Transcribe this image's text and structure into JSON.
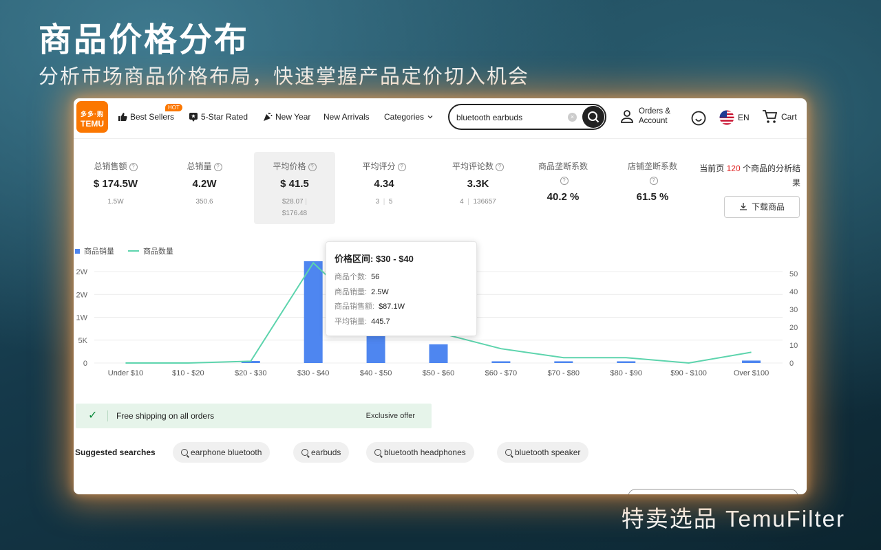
{
  "hero": {
    "title": "商品价格分布",
    "subtitle": "分析市场商品价格布局，快速掌握产品定价切入机会",
    "brand": "特卖选品 TemuFilter"
  },
  "nav": {
    "logo_line1": "多多·购",
    "logo_line2": "TEMU",
    "items": [
      "Best Sellers",
      "5-Star Rated",
      "New Year",
      "New Arrivals",
      "Categories"
    ],
    "hot_badge": "HOT",
    "search_value": "bluetooth earbuds",
    "orders_line1": "Orders &",
    "orders_line2": "Account",
    "lang": "EN",
    "cart": "Cart"
  },
  "stats": [
    {
      "label": "总销售额",
      "value": "$ 174.5W",
      "sub1": "1.5W",
      "sub2": ""
    },
    {
      "label": "总销量",
      "value": "4.2W",
      "sub1": "350.6",
      "sub2": ""
    },
    {
      "label": "平均价格",
      "value": "$ 41.5",
      "sub1": "$28.07",
      "sub2": "$176.48"
    },
    {
      "label": "平均评分",
      "value": "4.34",
      "sub1": "3",
      "sub2": "5"
    },
    {
      "label": "平均评论数",
      "value": "3.3K",
      "sub1": "4",
      "sub2": "136657"
    },
    {
      "label": "商品垄断系数",
      "value": "40.2 %",
      "sub1": "",
      "sub2": ""
    },
    {
      "label": "店铺垄断系数",
      "value": "61.5 %",
      "sub1": "",
      "sub2": ""
    }
  ],
  "summary": {
    "prefix": "当前页 ",
    "count": "120",
    "suffix": " 个商品的分析结果",
    "download": "下载商品"
  },
  "chart_data": {
    "type": "bar",
    "categories": [
      "Under $10",
      "$10 - $20",
      "$20 - $30",
      "$30 - $40",
      "$40 - $50",
      "$50 - $60",
      "$60 - $70",
      "$70 - $80",
      "$80 - $90",
      "$90 - $100",
      "Over $100"
    ],
    "series": [
      {
        "name": "商品销量",
        "type": "bar",
        "axis": "left",
        "color": "#4e86f0",
        "values": [
          0,
          0,
          500,
          25000,
          9600,
          4600,
          250,
          50,
          150,
          0,
          600
        ]
      },
      {
        "name": "商品数量",
        "type": "line",
        "axis": "right",
        "color": "#5dd4ad",
        "values": [
          0,
          0,
          1,
          56,
          23,
          17,
          8,
          3,
          3,
          0,
          6
        ]
      }
    ],
    "left_ticks": [
      "0",
      "5K",
      "1W",
      "2W",
      "2W"
    ],
    "right_ticks": [
      "0",
      "10",
      "20",
      "30",
      "40",
      "50"
    ],
    "left_max": 25000,
    "right_max": 56,
    "legend": "top-left"
  },
  "tooltip": {
    "title_label": "价格区间:",
    "title_value": "$30 - $40",
    "rows": [
      {
        "label": "商品个数:",
        "value": "56"
      },
      {
        "label": "商品销量:",
        "value": "2.5W"
      },
      {
        "label": "商品销售额:",
        "value": "$87.1W"
      },
      {
        "label": "平均销量:",
        "value": "445.7"
      }
    ]
  },
  "shipping": {
    "text": "Free shipping on all orders",
    "offer": "Exclusive offer"
  },
  "suggested": {
    "label": "Suggested searches",
    "items": [
      "earphone bluetooth",
      "earbuds",
      "bluetooth headphones",
      "bluetooth speaker"
    ]
  }
}
